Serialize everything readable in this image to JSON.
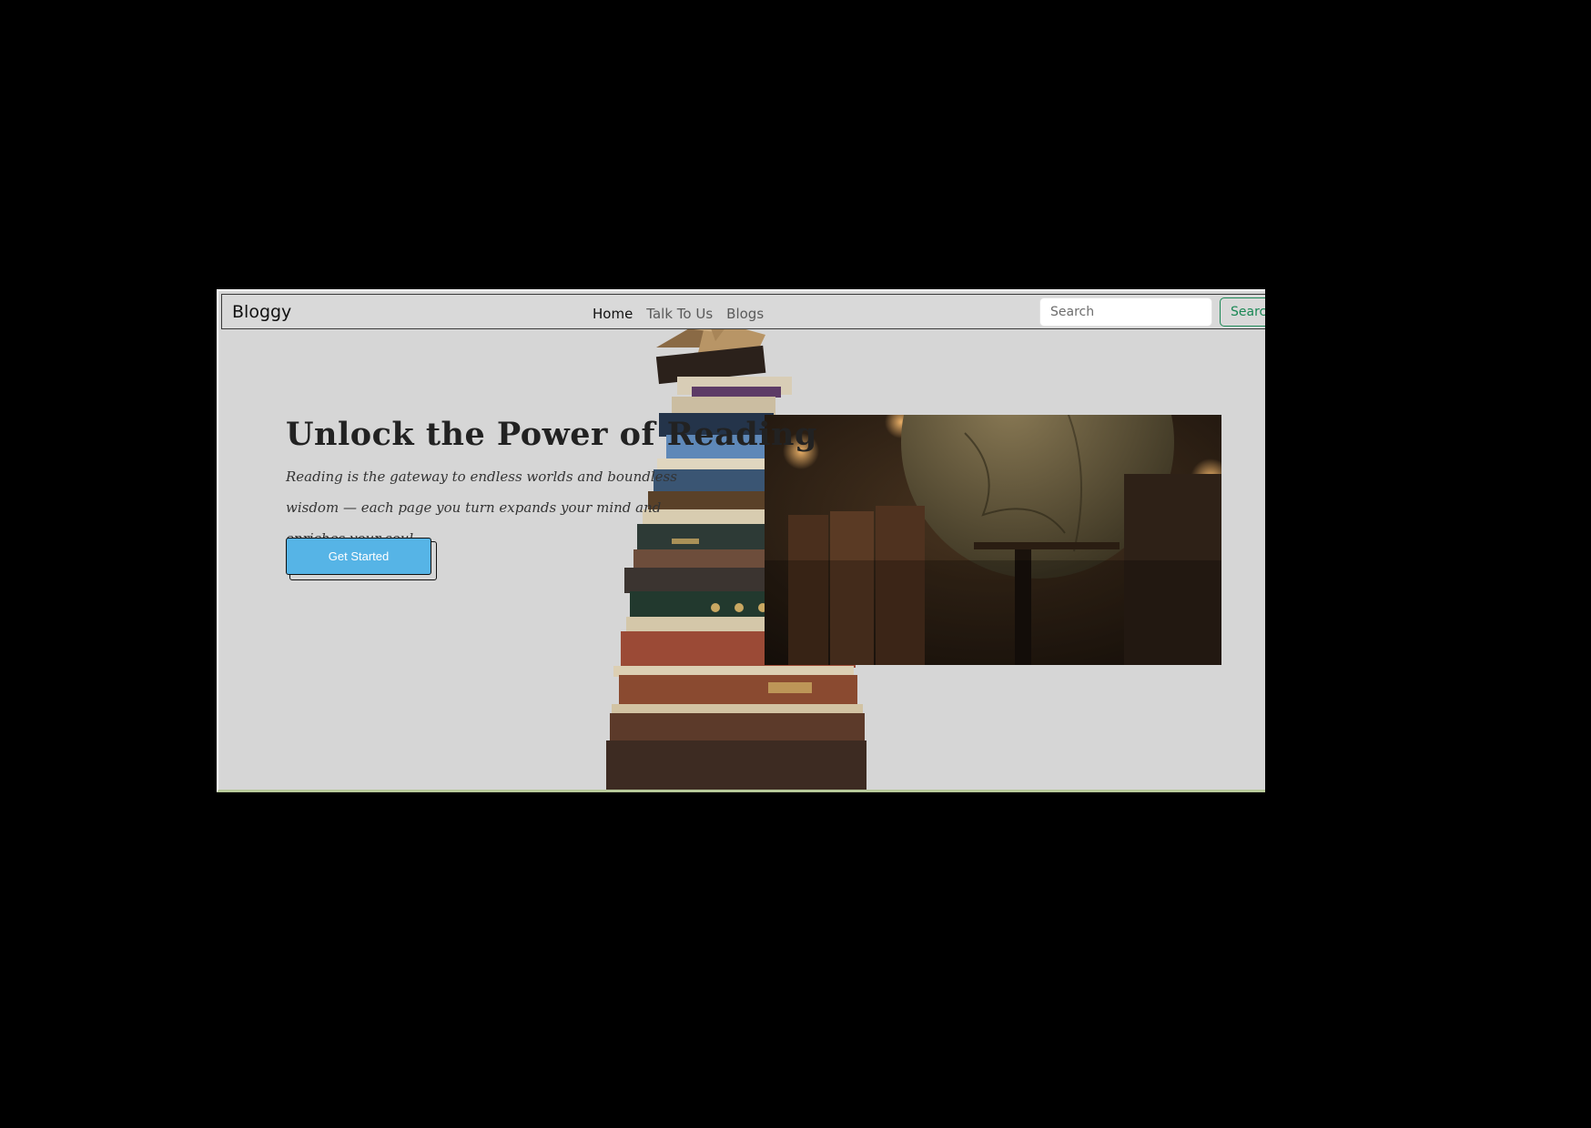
{
  "navbar": {
    "brand": "Bloggy",
    "links": [
      "Home",
      "Talk To Us",
      "Blogs"
    ],
    "active_link": "Home",
    "search_placeholder": "Search",
    "search_button": "Search"
  },
  "hero": {
    "title": "Unlock the Power of Reading",
    "text": "Reading is the gateway to endless worlds and boundless wisdom — each page you turn expands your mind and enriches your soul.",
    "cta": "Get Started"
  },
  "colors": {
    "page_background": "#d6d6d6",
    "cta_background": "#56b4e6",
    "search_button": "#198754"
  },
  "images": {
    "illustration": "stack-of-old-books",
    "photo": "antique-globe-and-books"
  }
}
